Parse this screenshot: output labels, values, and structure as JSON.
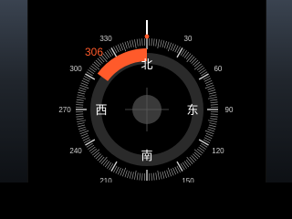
{
  "compass": {
    "heading": 306,
    "heading_text": "306",
    "degree_labels": [
      {
        "deg": 30,
        "text": "30"
      },
      {
        "deg": 60,
        "text": "60"
      },
      {
        "deg": 90,
        "text": "90"
      },
      {
        "deg": 120,
        "text": "120"
      },
      {
        "deg": 150,
        "text": "150"
      },
      {
        "deg": 210,
        "text": "210"
      },
      {
        "deg": 240,
        "text": "240"
      },
      {
        "deg": 270,
        "text": "270"
      },
      {
        "deg": 300,
        "text": "300"
      },
      {
        "deg": 330,
        "text": "330"
      }
    ],
    "cardinals": [
      {
        "deg": 0,
        "text": "北",
        "name": "north"
      },
      {
        "deg": 90,
        "text": "东",
        "name": "east"
      },
      {
        "deg": 180,
        "text": "南",
        "name": "south"
      },
      {
        "deg": 270,
        "text": "西",
        "name": "west"
      }
    ],
    "colors": {
      "accent": "#ff5a2a",
      "text": "#ffffff",
      "tick": "#cfcfcf",
      "center": "#3a3a3a",
      "inner_ring": "#2a2a2a"
    },
    "icons": [
      "heading-indicator-icon",
      "level-bubble-icon"
    ]
  }
}
